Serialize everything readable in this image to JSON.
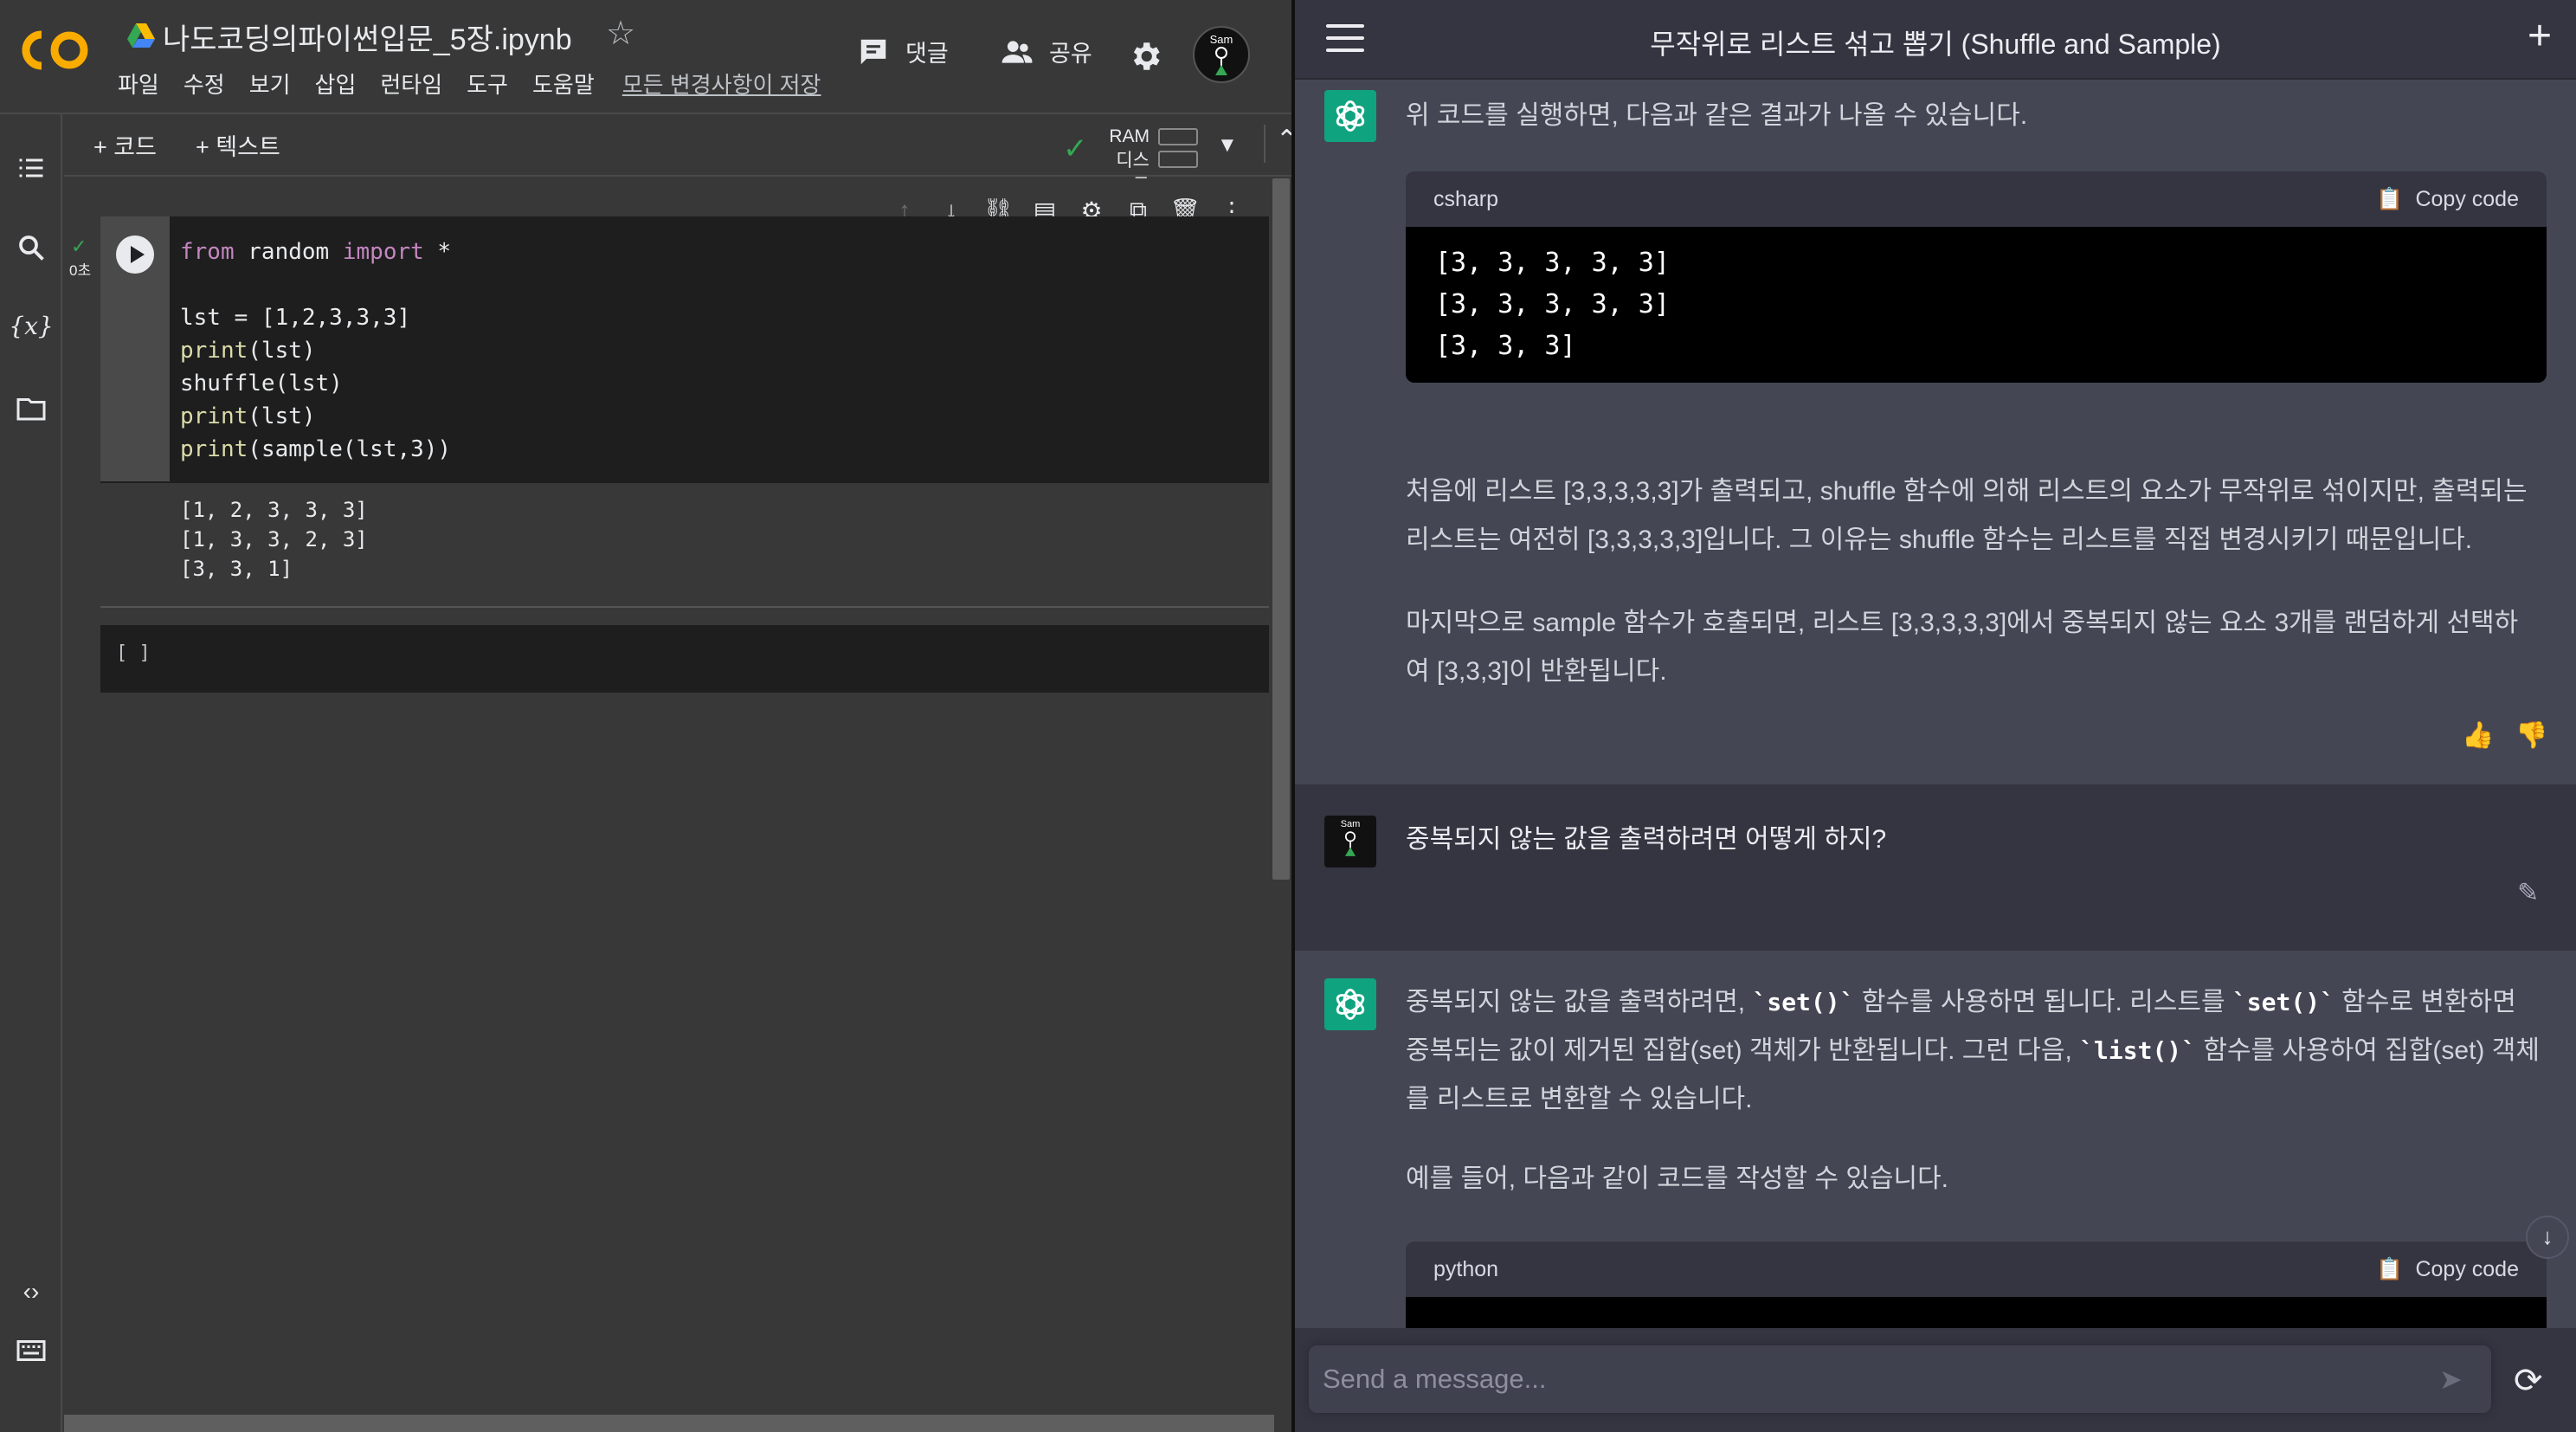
{
  "colab": {
    "notebook_title": "나도코딩의파이썬입문_5장.ipynb",
    "menu": [
      "파일",
      "수정",
      "보기",
      "삽입",
      "런타임",
      "도구",
      "도움말"
    ],
    "save_status": "모든 변경사항이 저장",
    "comment_label": "댓글",
    "share_label": "공유",
    "avatar_label": "Sam",
    "toolbar": {
      "add_code": "+ 코드",
      "add_text": "+ 텍스트",
      "ram_label": "RAM",
      "disk_label": "디스크"
    },
    "cell": {
      "exec_time": "0초",
      "code_lines": [
        [
          "from",
          " random ",
          "import",
          " *"
        ],
        [
          ""
        ],
        [
          "lst = [1,2,3,3,3]"
        ],
        [
          "print",
          "(lst)"
        ],
        [
          "shuffle(lst)"
        ],
        [
          "print",
          "(lst)"
        ],
        [
          "print",
          "(",
          "sample",
          "(lst,3))"
        ]
      ],
      "output_lines": [
        "[1, 2, 3, 3, 3]",
        "[1, 3, 3, 2, 3]",
        "[3, 3, 1]"
      ],
      "empty_cell_label": "[ ]"
    }
  },
  "chat": {
    "title": "무작위로 리스트 섞고 뽑기 (Shuffle and Sample)",
    "messages": {
      "ai1_intro": "위 코드를 실행하면, 다음과 같은 결과가 나올 수 있습니다.",
      "ai1_code_lang": "csharp",
      "copy_label": "Copy code",
      "ai1_code": "[3, 3, 3, 3, 3]\n[3, 3, 3, 3, 3]\n[3, 3, 3]",
      "ai1_p1": "처음에 리스트 [3,3,3,3,3]가 출력되고, shuffle 함수에 의해 리스트의 요소가 무작위로 섞이지만, 출력되는 리스트는 여전히 [3,3,3,3,3]입니다. 그 이유는 shuffle 함수는 리스트를 직접 변경시키기 때문입니다.",
      "ai1_p2": "마지막으로 sample 함수가 호출되면, 리스트 [3,3,3,3,3]에서 중복되지 않는 요소 3개를 랜덤하게 선택하여 [3,3,3]이 반환됩니다.",
      "user_msg": "중복되지 않는 값을 출력하려면 어떻게 하지?",
      "user_avatar_label": "Sam",
      "ai2_p1_a": "중복되지 않는 값을 출력하려면, ",
      "ai2_code_set": "`set()`",
      "ai2_p1_b": " 함수를 사용하면 됩니다. 리스트를 ",
      "ai2_p1_c": " 함수로 변환하면 중복되는 값이 제거된 집합(set) 객체가 반환됩니다. 그런 다음, ",
      "ai2_code_list": "`list()`",
      "ai2_p1_d": " 함수를 사용하여 집합(set) 객체를 리스트로 변환할 수 있습니다.",
      "ai2_p2": "예를 들어, 다음과 같이 코드를 작성할 수 있습니다.",
      "ai2_code_lang": "python"
    },
    "composer_placeholder": "Send a message..."
  }
}
